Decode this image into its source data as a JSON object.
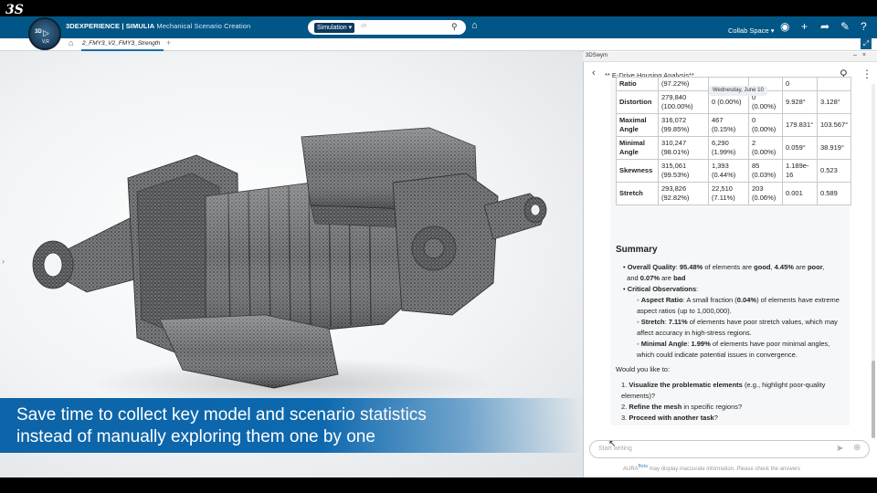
{
  "header": {
    "logo_text": "3S",
    "compass_3d": "3D",
    "compass_vr": "V,R",
    "brand_bold": "3DEXPERIENCE | SIMULIA",
    "brand_sub": "Mechanical Scenario Creation",
    "search_select": "Simulation",
    "search_placeholder": "ch",
    "space_label": "Collab Space",
    "icons": [
      "search-icon",
      "tag-icon",
      "user-icon",
      "plus-icon",
      "share-icon",
      "tools-icon",
      "help-icon"
    ]
  },
  "tabs": {
    "active_doc": "2_FMY3_V2_FMY3_Strength",
    "add_symbol": "+"
  },
  "viewport": {
    "caption_line1": "Save time to collect key model and scenario statistics",
    "caption_line2": "instead of manually exploring them one by one"
  },
  "panel": {
    "app_label": "3DSwym",
    "chat_title": "** E-Drive Housing Analysis**",
    "date_pill": "Wednesday, June 10",
    "table": {
      "rows": [
        {
          "name": "Ratio",
          "c1": "(97.22%)",
          "c2": "",
          "c3": "",
          "c4": "0",
          "c5": ""
        },
        {
          "name": "Distortion",
          "c1": "279,840 (100.00%)",
          "c2": "0 (0.00%)",
          "c3": "0 (0.00%)",
          "c4": "9.928°",
          "c5": "3.128°"
        },
        {
          "name": "Maximal Angle",
          "c1": "316,072 (99.85%)",
          "c2": "467 (0.15%)",
          "c3": "0 (0.00%)",
          "c4": "179.831°",
          "c5": "103.567°"
        },
        {
          "name": "Minimal Angle",
          "c1": "310,247 (98.01%)",
          "c2": "6,290 (1.99%)",
          "c3": "2 (0.00%)",
          "c4": "0.059°",
          "c5": "38.919°"
        },
        {
          "name": "Skewness",
          "c1": "315,061 (99.53%)",
          "c2": "1,393 (0.44%)",
          "c3": "85 (0.03%)",
          "c4": "1.189e-16",
          "c5": "0.523"
        },
        {
          "name": "Stretch",
          "c1": "293,826 (92.82%)",
          "c2": "22,510 (7.11%)",
          "c3": "203 (0.06%)",
          "c4": "0.001",
          "c5": "0.589"
        }
      ]
    },
    "summary_title": "Summary",
    "overall_label": "Overall Quality",
    "overall_good": "95.48%",
    "overall_poor": "4.45%",
    "overall_bad": "0.07%",
    "critical_label": "Critical Observations",
    "aspect_label": "Aspect Ratio",
    "aspect_pct": "0.04%",
    "aspect_text_a": ": A small fraction (",
    "aspect_text_b": ") of elements have extreme aspect ratios (up to 1,000,000).",
    "stretch_label": "Stretch",
    "stretch_pct": "7.11%",
    "stretch_text": "of elements have poor stretch values, which may affect accuracy in high-stress regions.",
    "minangle_label": "Minimal Angle",
    "minangle_pct": "1.99%",
    "minangle_text": "of elements have poor minimal angles, which could indicate potential issues in convergence.",
    "question": "Would you like to:",
    "opt1_bold": "Visualize the problematic elements",
    "opt1_rest": "(e.g., highlight poor-quality elements)?",
    "opt2_bold": "Refine the mesh",
    "opt2_rest": "in specific regions?",
    "opt3_bold": "Proceed with another task",
    "opt3_rest": "?",
    "input_placeholder": "Start writing",
    "disclaimer_prefix": "AURA",
    "disclaimer_beta": "Beta",
    "disclaimer_text": "may display inaccurate information. Please check the answers"
  }
}
